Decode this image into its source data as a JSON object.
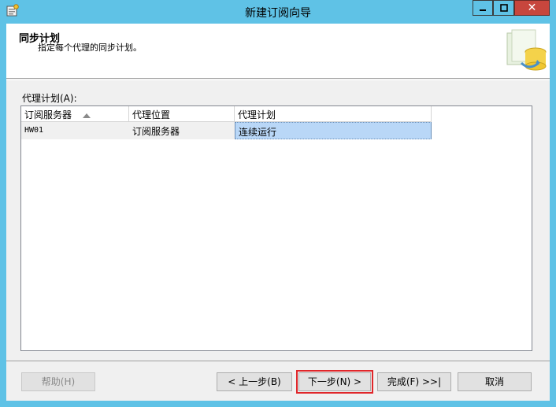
{
  "window": {
    "title": "新建订阅向导",
    "close_glyph": "✕"
  },
  "header": {
    "title": "同步计划",
    "subtitle": "指定每个代理的同步计划。"
  },
  "grid": {
    "label": "代理计划(A):",
    "columns": [
      "订阅服务器",
      "代理位置",
      "代理计划"
    ],
    "sort_column": 0,
    "rows": [
      [
        "HW01",
        "订阅服务器",
        "连续运行"
      ]
    ]
  },
  "buttons": {
    "help": "帮助(H)",
    "back": "< 上一步(B)",
    "next": "下一步(N) >",
    "finish": "完成(F) >>|",
    "cancel": "取消"
  },
  "colors": {
    "titlebar": "#5fc2e6",
    "close_button": "#c7463d",
    "selection": "#b9d7f7",
    "focus_highlight": "#e0262a"
  }
}
